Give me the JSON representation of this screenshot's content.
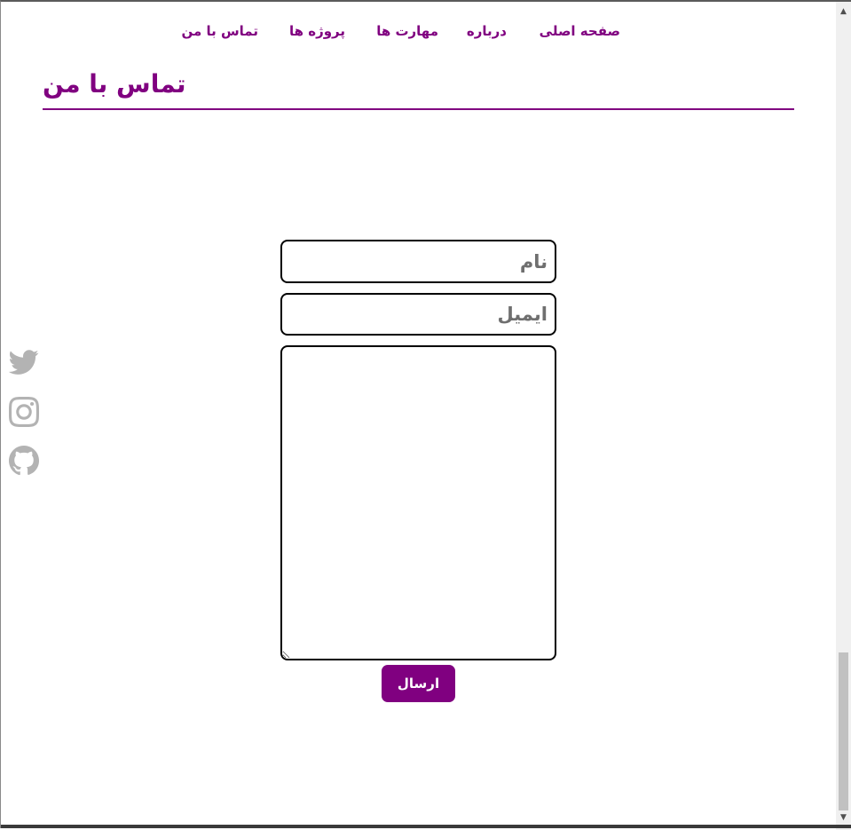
{
  "nav": {
    "items": [
      {
        "label": "صفحه اصلی"
      },
      {
        "label": "درباره"
      },
      {
        "label": "مهارت ها"
      },
      {
        "label": "پروژه ها"
      },
      {
        "label": "تماس با من"
      }
    ]
  },
  "page": {
    "title": "تماس با من",
    "accent_color": "#800080"
  },
  "social": {
    "icons": [
      "twitter-icon",
      "instagram-icon",
      "github-icon"
    ],
    "color": "#b3b3b3"
  },
  "form": {
    "name_placeholder": "نام",
    "email_placeholder": "ایمیل",
    "message_value": "",
    "send_label": "ارسال"
  },
  "scrollbar": {
    "up_glyph": "▲",
    "down_glyph": "▼"
  }
}
